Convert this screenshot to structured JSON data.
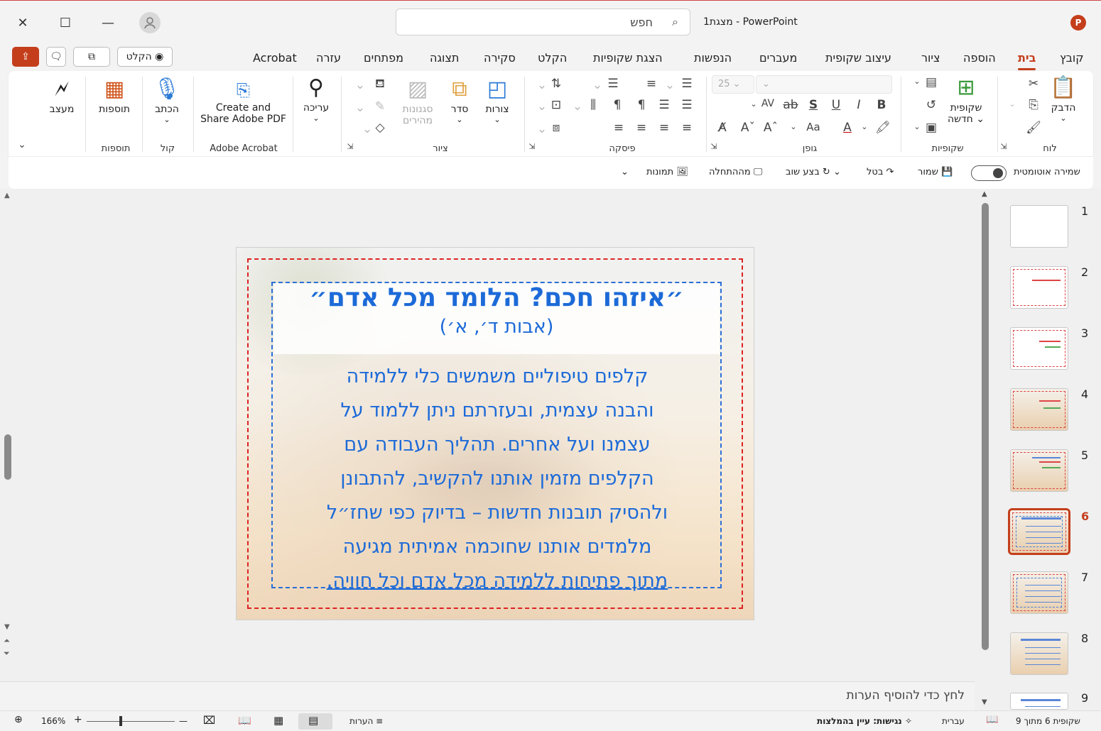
{
  "window": {
    "title": "מצגת1  -  PowerPoint",
    "app_logo": "P",
    "search_placeholder": "חפש",
    "close_icon": "✕",
    "maximize_icon": "☐",
    "minimize_icon": "—"
  },
  "tabs": [
    "קובץ",
    "בית",
    "הוספה",
    "ציור",
    "עיצוב שקופית",
    "מעברים",
    "הנפשות",
    "הצגת שקופיות",
    "הקלט",
    "סקירה",
    "תצוגה",
    "מפתחים",
    "עזרה",
    "Acrobat"
  ],
  "active_tab": "בית",
  "record_button": "הקלט",
  "ribbon": {
    "groups": {
      "clipboard": "לוח",
      "slides": "שקופיות",
      "font": "גופן",
      "paragraph": "פיסקה",
      "drawing": "ציור",
      "acrobat": "Adobe Acrobat",
      "voice": "קול",
      "addins": "תוספות"
    },
    "buttons": {
      "paste": "הדבק",
      "new_slide_1": "שקופית",
      "new_slide_2": "חדשה",
      "font_size": "25",
      "shapes": "צורות",
      "arrange": "סדר",
      "quick_styles_1": "סגנונות",
      "quick_styles_2": "מהירים",
      "editing": "עריכה",
      "create_pdf_1": "Create and",
      "create_pdf_2": "Share Adobe PDF",
      "dictate": "הכתב",
      "addins": "תוספות",
      "designer": "מעצב"
    }
  },
  "qat": {
    "autosave": "שמירה אוטומטית",
    "save": "שמור",
    "undo": "בטל",
    "redo": "בצע שוב",
    "from_start": "מההתחלה",
    "pictures": "תמונות"
  },
  "slide": {
    "title": "״איזהו חכם? הלומד מכל אדם״",
    "subtitle": "(אבות ד׳, א׳)",
    "body_lines": [
      "קלפים טיפוליים משמשים כלי ללמידה",
      "והבנה עצמית, ובעזרתם ניתן ללמוד על",
      "עצמנו ועל אחרים. תהליך העבודה עם",
      "הקלפים מזמין אותנו להקשיב, להתבונן",
      "ולהסיק תובנות חדשות – בדיוק כפי שחז״ל",
      "מלמדים אותנו שחוכמה אמיתית מגיעה"
    ],
    "body_last_line": "מתוך פתיחות ללמידה מכל אדם וכל חוויה."
  },
  "thumbnails": [
    "1",
    "2",
    "3",
    "4",
    "5",
    "6",
    "7",
    "8",
    "9"
  ],
  "selected_slide": "6",
  "notes_placeholder": "לחץ כדי להוסיף הערות",
  "status": {
    "slide_counter": "שקופית 6 מתוך 9",
    "language": "עברית",
    "accessibility": "נגישות: עיין בהמלצות",
    "notes": "הערות",
    "zoom": "166%",
    "zoom_minus": "—",
    "zoom_plus": "+"
  },
  "colors": {
    "accent": "#c43e1c",
    "slide_text": "#1c6ad8",
    "frame_red": "#dd2222",
    "frame_blue": "#2a6fd6"
  }
}
